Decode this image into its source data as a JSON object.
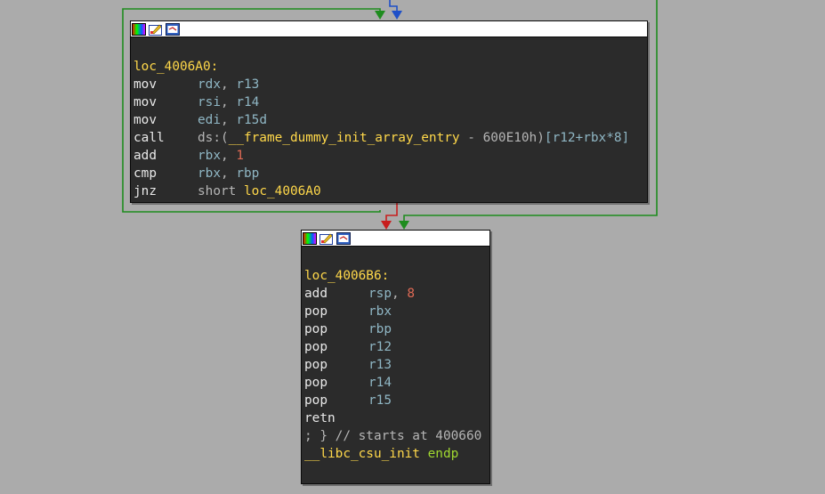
{
  "colors": {
    "background": "#ababab",
    "node_bg": "#2b2b2b",
    "edge_true": "#1e8c1e",
    "edge_false": "#c81e1e",
    "edge_normal": "#1e50c8"
  },
  "header_icons": [
    "graph-colors-icon",
    "rename-node-icon",
    "group-nodes-icon"
  ],
  "node1": {
    "label": "loc_4006A0:",
    "lines": [
      {
        "mn": "mov",
        "op1": "rdx",
        "sep": ", ",
        "op2": "r13"
      },
      {
        "mn": "mov",
        "op1": "rsi",
        "sep": ", ",
        "op2": "r14"
      },
      {
        "mn": "mov",
        "op1": "edi",
        "sep": ", ",
        "op2": "r15d"
      },
      {
        "mn": "call",
        "ds": "ds:(",
        "sym": "__frame_dummy_init_array_entry",
        "minus": " - ",
        "addr": "600E10h",
        "close": ")",
        "idx": "[r12+rbx*8]"
      },
      {
        "mn": "add",
        "op1": "rbx",
        "sep": ", ",
        "op2": "1"
      },
      {
        "mn": "cmp",
        "op1": "rbx",
        "sep": ", ",
        "op2": "rbp"
      },
      {
        "mn": "jnz",
        "op1": "short",
        "op2": "loc_4006A0"
      }
    ]
  },
  "node2": {
    "label": "loc_4006B6:",
    "lines": [
      {
        "mn": "add",
        "op1": "rsp",
        "sep": ", ",
        "op2": "8"
      },
      {
        "mn": "pop",
        "op1": "rbx"
      },
      {
        "mn": "pop",
        "op1": "rbp"
      },
      {
        "mn": "pop",
        "op1": "r12"
      },
      {
        "mn": "pop",
        "op1": "r13"
      },
      {
        "mn": "pop",
        "op1": "r14"
      },
      {
        "mn": "pop",
        "op1": "r15"
      },
      {
        "mn": "retn"
      }
    ],
    "comment": "; } // starts at 400660",
    "func_name": "__libc_csu_init",
    "endp": "endp"
  }
}
